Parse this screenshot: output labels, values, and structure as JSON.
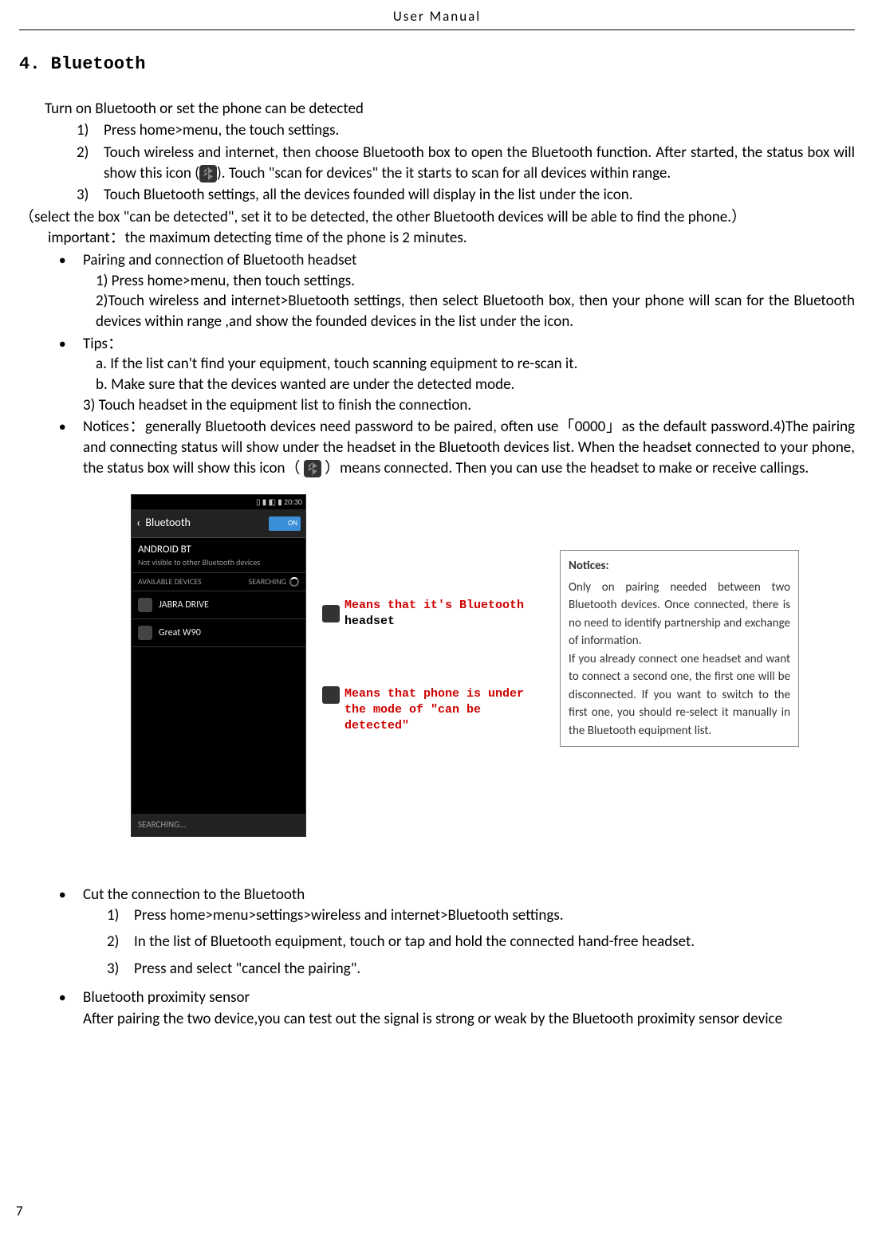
{
  "header": {
    "title": "User    Manual"
  },
  "section": {
    "title": "4. Bluetooth"
  },
  "intro": "Turn on Bluetooth or set the phone can be detected",
  "steps": {
    "n1": "1)",
    "t1": "Press home>menu, the touch settings.",
    "n2": "2)",
    "t2a": "Touch wireless and internet, then choose Bluetooth box to open the Bluetooth function. After started, the status box will show this icon (",
    "t2b": "). Touch   \"scan for devices\" the it starts to scan for all devices within range.",
    "n3": "3)",
    "t3": "Touch Bluetooth settings, all the devices founded will display in the list under the icon."
  },
  "selectNote": "（select the box \"can be detected\", set it to be detected, the other Bluetooth devices will be able to find the phone.）",
  "important": "important：the maximum detecting time of the phone is 2 minutes.",
  "bullet1": {
    "title": "Pairing and connection of Bluetooth headset",
    "s1": "1) Press home>menu, then touch settings.",
    "s2": "2)Touch wireless and internet>Bluetooth settings, then select Bluetooth box, then your phone will scan for the Bluetooth devices within range ,and show the founded devices in the list under the icon."
  },
  "bullet2": {
    "title": "Tips：",
    "a": "a.  If the list can't find your equipment, touch scanning equipment to re-scan it.",
    "b": "b.  Make sure that the devices wanted are under the detected mode.",
    "s3": "3) Touch headset in the equipment list to finish the connection."
  },
  "bullet3": {
    "pre": "Notices：generally Bluetooth devices need password to be paired, often use「0000」as the default password.4)The pairing and connecting status will show under the headset in the Bluetooth devices list. When the headset connected to your phone, the status box will show this icon（",
    "post": "）means connected. Then you can use the headset to make or receive callings."
  },
  "phone": {
    "status_time": "20:30",
    "title": "Bluetooth",
    "toggle": "ON",
    "device_name": "ANDROID BT",
    "device_sub": "Not visible to other Bluetooth devices",
    "avail_label": "AVAILABLE DEVICES",
    "searching": "SEARCHING",
    "dev1": "JABRA DRIVE",
    "dev2": "Great W90",
    "bottom": "SEARCHING..."
  },
  "callout1": {
    "red": "Means that it's Bluetooth",
    "black": "headset"
  },
  "callout2": {
    "red": "Means that phone is under the mode of \"can be detected\"",
    "black": ""
  },
  "noticeBox": {
    "title": "Notices:",
    "body": "Only on pairing needed between two Bluetooth devices. Once connected, there is no need to identify partnership and exchange of information.\nIf you already connect one headset and want to connect a second one, the first one will be disconnected. If you want to switch to the first one, you should re-select it manually in the Bluetooth equipment list."
  },
  "bullet4": {
    "title": "Cut the connection to the Bluetooth",
    "n1": "1)",
    "t1": "Press home>menu>settings>wireless and internet>Bluetooth settings.",
    "n2": "2)",
    "t2": "In the list of Bluetooth equipment, touch or tap and hold the connected hand-free headset.",
    "n3": "3)",
    "t3": "Press and select \"cancel the pairing\"."
  },
  "bullet5": {
    "title": "Bluetooth proximity sensor",
    "after": "After pairing the two device,you can test out the signal is strong or weak by the Bluetooth proximity sensor device"
  },
  "pageNumber": "7"
}
